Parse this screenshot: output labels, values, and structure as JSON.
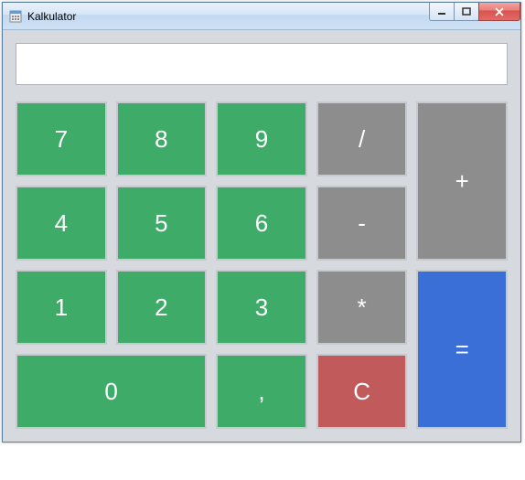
{
  "window": {
    "title": "Kalkulator"
  },
  "display": {
    "value": ""
  },
  "keys": {
    "n7": "7",
    "n8": "8",
    "n9": "9",
    "n4": "4",
    "n5": "5",
    "n6": "6",
    "n1": "1",
    "n2": "2",
    "n3": "3",
    "n0": "0",
    "divide": "/",
    "minus": "-",
    "multiply": "*",
    "plus": "+",
    "equals": "=",
    "comma": ",",
    "clear": "C"
  },
  "colors": {
    "number": "#3fab69",
    "operator": "#8d8d8d",
    "clear": "#c15b5b",
    "equals": "#3a6fd8"
  }
}
